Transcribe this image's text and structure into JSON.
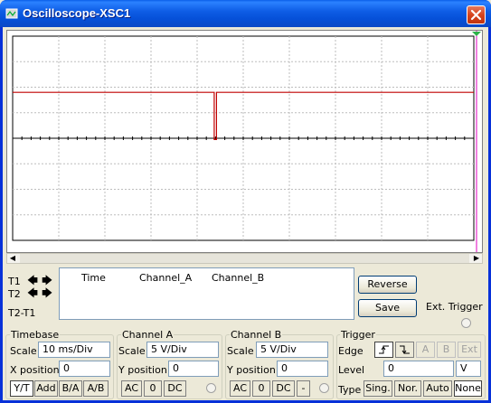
{
  "window": {
    "title": "Oscilloscope-XSC1"
  },
  "chart_data": {
    "type": "line",
    "grid": true,
    "grid_divisions": {
      "x": 10,
      "y": 8
    },
    "series": [
      {
        "color": "#c00000",
        "x_div": [
          0,
          4.37,
          4.37,
          4.42,
          4.42,
          10
        ],
        "y_div": [
          1.8,
          1.8,
          -0.05,
          -0.05,
          1.8,
          1.8
        ]
      }
    ],
    "center_axis": true
  },
  "readout": {
    "time_label": "Time",
    "channel_a_label": "Channel_A",
    "channel_b_label": "Channel_B"
  },
  "cursors": {
    "t1": "T1",
    "t2": "T2",
    "t2_t1": "T2-T1"
  },
  "buttons": {
    "reverse": "Reverse",
    "save": "Save"
  },
  "ext_trigger": "Ext. Trigger",
  "timebase": {
    "title": "Timebase",
    "scale_label": "Scale",
    "scale_value": "10 ms/Div",
    "xpos_label": "X position",
    "xpos_value": "0",
    "modes": [
      "Y/T",
      "Add",
      "B/A",
      "A/B"
    ]
  },
  "channel_a": {
    "title": "Channel A",
    "scale_label": "Scale",
    "scale_value": "5  V/Div",
    "ypos_label": "Y position",
    "ypos_value": "0",
    "coupling": [
      "AC",
      "0",
      "DC"
    ]
  },
  "channel_b": {
    "title": "Channel B",
    "scale_label": "Scale",
    "scale_value": "5  V/Div",
    "ypos_label": "Y position",
    "ypos_value": "0",
    "coupling": [
      "AC",
      "0",
      "DC",
      "-"
    ]
  },
  "trigger": {
    "title": "Trigger",
    "edge_label": "Edge",
    "edge_buttons": [
      "A",
      "B",
      "Ext"
    ],
    "level_label": "Level",
    "level_value": "0",
    "level_unit": "V",
    "type_label": "Type",
    "type_buttons": [
      "Sing.",
      "Nor.",
      "Auto",
      "None"
    ]
  }
}
